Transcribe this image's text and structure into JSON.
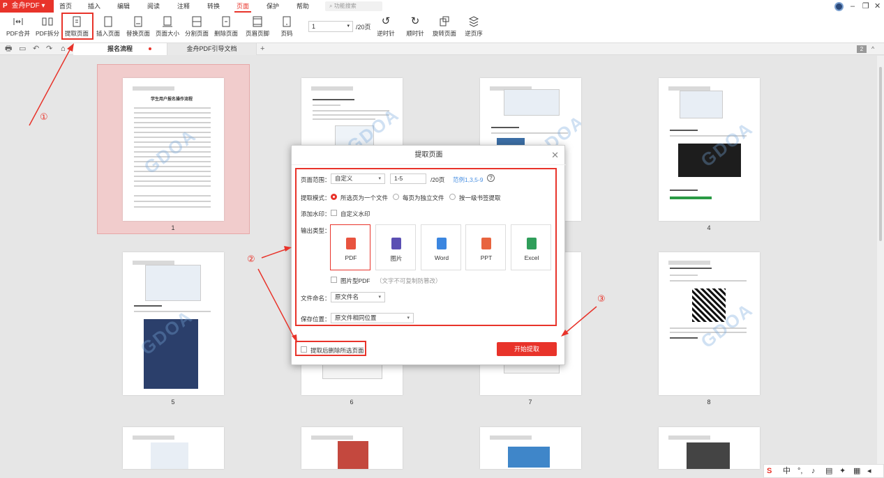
{
  "app": {
    "name": "金舟PDF",
    "brand_color": "#e8332a"
  },
  "menu": {
    "items": [
      "首页",
      "插入",
      "编辑",
      "阅读",
      "注释",
      "转换",
      "页面",
      "保护",
      "帮助"
    ],
    "active": "页面",
    "search_placeholder": "功能搜索"
  },
  "toolbar": {
    "buttons": [
      "PDF合并",
      "PDF拆分",
      "提取页面",
      "插入页面",
      "替换页面",
      "页面大小",
      "分割页面",
      "删除页面",
      "页眉页脚",
      "页码",
      "逆时针",
      "顺时针",
      "旋转页面",
      "逆页序"
    ],
    "page_value": "1",
    "page_total": "/20页"
  },
  "tabs": [
    {
      "label": "报名流程"
    },
    {
      "label": "金舟PDF引导文档"
    }
  ],
  "tab_add": "+",
  "page_badge": "2",
  "thumbnails": {
    "page_numbers": [
      "1",
      "4",
      "5",
      "6",
      "7",
      "8"
    ],
    "watermark": "GDOA",
    "page1_title": "学生用户报名操作流程"
  },
  "dialog": {
    "title": "提取页面",
    "range_label": "页面范围：",
    "range_select": "自定义",
    "range_input": "1-5",
    "range_total": "/20页",
    "range_hint": "范例1,3,5-9",
    "mode_label": "提取模式：",
    "modes": [
      "所选页为一个文件",
      "每页为独立文件",
      "按一级书签提取"
    ],
    "watermark_label": "添加水印：",
    "watermark_option": "自定义水印",
    "output_label": "输出类型：",
    "output_types": [
      "PDF",
      "图片",
      "Word",
      "PPT",
      "Excel"
    ],
    "image_pdf_label": "图片型PDF",
    "image_pdf_note": "（文字不可复制防篡改）",
    "filename_label": "文件命名：",
    "filename_value": "原文件名",
    "save_label": "保存位置：",
    "save_value": "原文件相同位置",
    "delete_after": "提取后删除所选页面",
    "start_button": "开始提取"
  },
  "annotations": [
    "①",
    "②",
    "③"
  ],
  "taskbar": {
    "ime": "中"
  }
}
